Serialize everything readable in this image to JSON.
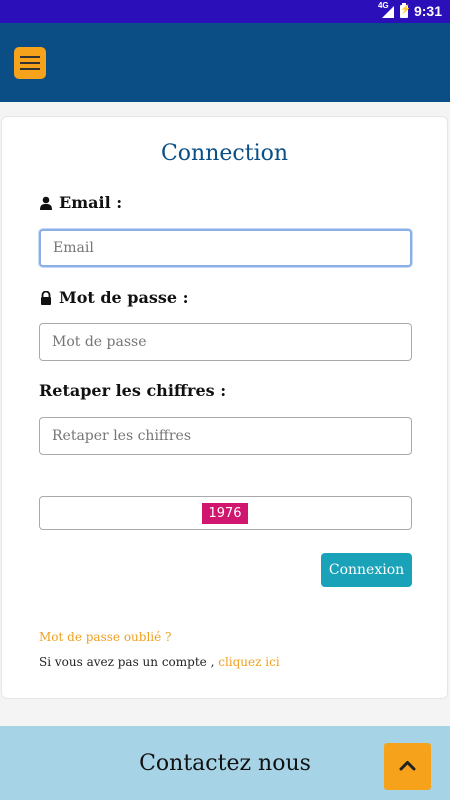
{
  "statusbar": {
    "network": "4G",
    "time": "9:31"
  },
  "colors": {
    "appbar": "#0a4e85",
    "accent": "#f6a21a",
    "button": "#1aa3b8",
    "captcha": "#d11670",
    "footer": "#a7d3e6"
  },
  "header": {
    "menu_icon": "hamburger-icon"
  },
  "form": {
    "title": "Connection",
    "email_label": "Email :",
    "email_placeholder": "Email",
    "password_label": "Mot de passe :",
    "password_placeholder": "Mot de passe",
    "captcha_label": "Retaper les chiffres :",
    "captcha_placeholder": "Retaper les chiffres",
    "captcha_code": "1976",
    "submit_label": "Connexion",
    "forgot_password": "Mot de passe oublié ?",
    "signup_text": "Si vous avez pas un compte ,",
    "signup_link": "cliquez ici"
  },
  "footer": {
    "title": "Contactez nous",
    "scroll_icon": "chevron-up-icon"
  }
}
